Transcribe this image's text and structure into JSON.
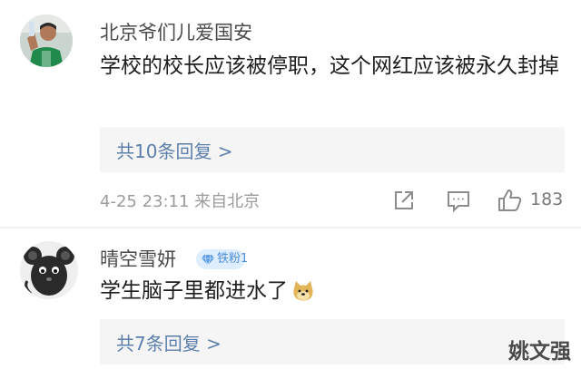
{
  "comments": [
    {
      "username": "北京爷们儿爱国安",
      "text": "学校的校长应该被停职，这个网红应该被永久封掉",
      "reply_link": "共10条回复 >",
      "meta": "4-25 23:11 来自北京",
      "like_count": "183",
      "icons": [
        "share-icon",
        "comment-icon",
        "like-icon"
      ]
    },
    {
      "username": "晴空雪妍",
      "badge": "铁粉1",
      "text": "学生脑子里都进水了",
      "emoji": "doge-emoji",
      "reply_link": "共7条回复 >"
    }
  ],
  "watermark": "姚文强",
  "colors": {
    "link": "#5c7fab",
    "meta": "#9b9b9b",
    "reply_box": "#f5f5f5",
    "badge_bg": "#dfeefe",
    "badge_text": "#4f8fda"
  }
}
